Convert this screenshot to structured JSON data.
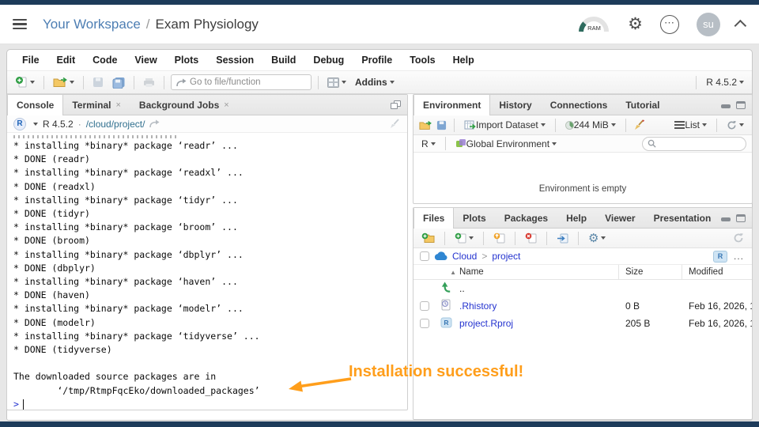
{
  "header": {
    "workspace": "Your Workspace",
    "separator": "/",
    "project": "Exam Physiology",
    "ram_label": "RAM",
    "avatar_initials": "su"
  },
  "menubar": {
    "items": [
      "File",
      "Edit",
      "Code",
      "View",
      "Plots",
      "Session",
      "Build",
      "Debug",
      "Profile",
      "Tools",
      "Help"
    ]
  },
  "toolbar": {
    "goto_placeholder": "Go to file/function",
    "addins_label": "Addins",
    "r_version_label": "R 4.5.2"
  },
  "console_pane": {
    "tabs": [
      {
        "label": "Console",
        "active": true
      },
      {
        "label": "Terminal",
        "closable": true
      },
      {
        "label": "Background Jobs",
        "closable": true
      }
    ],
    "r_version": "R 4.5.2",
    "dot": "·",
    "working_dir": "/cloud/project/",
    "output_lines": [
      "* installing *binary* package ‘readr’ ...",
      "* DONE (readr)",
      "* installing *binary* package ‘readxl’ ...",
      "* DONE (readxl)",
      "* installing *binary* package ‘tidyr’ ...",
      "* DONE (tidyr)",
      "* installing *binary* package ‘broom’ ...",
      "* DONE (broom)",
      "* installing *binary* package ‘dbplyr’ ...",
      "* DONE (dbplyr)",
      "* installing *binary* package ‘haven’ ...",
      "* DONE (haven)",
      "* installing *binary* package ‘modelr’ ...",
      "* DONE (modelr)",
      "* installing *binary* package ‘tidyverse’ ...",
      "* DONE (tidyverse)",
      "",
      "The downloaded source packages are in",
      "        ‘/tmp/RtmpFqcEko/downloaded_packages’"
    ],
    "prompt": ">"
  },
  "environment_pane": {
    "tabs": [
      {
        "label": "Environment",
        "active": true
      },
      {
        "label": "History"
      },
      {
        "label": "Connections"
      },
      {
        "label": "Tutorial"
      }
    ],
    "import_label": "Import Dataset",
    "memory_label": "244 MiB",
    "list_label": "List",
    "language_label": "R",
    "scope_label": "Global Environment",
    "empty_message": "Environment is empty"
  },
  "files_pane": {
    "tabs": [
      {
        "label": "Files",
        "active": true
      },
      {
        "label": "Plots"
      },
      {
        "label": "Packages"
      },
      {
        "label": "Help"
      },
      {
        "label": "Viewer"
      },
      {
        "label": "Presentation"
      }
    ],
    "breadcrumb": {
      "root": "Cloud",
      "separator": ">",
      "current": "project"
    },
    "project_badge": "R",
    "overflow_label": "...",
    "columns": {
      "name": "Name",
      "size": "Size",
      "modified": "Modified",
      "sort_glyph": "▲"
    },
    "rows": [
      {
        "icon": "up-dir-icon",
        "name": "..",
        "size": "",
        "modified": "",
        "link": false,
        "checkbox": false
      },
      {
        "icon": "rhistory-file-icon",
        "name": ".Rhistory",
        "size": "0 B",
        "modified": "Feb 16, 2026, 1",
        "link": true,
        "checkbox": true
      },
      {
        "icon": "rproj-file-icon",
        "name": "project.Rproj",
        "size": "205 B",
        "modified": "Feb 16, 2026, 1",
        "link": true,
        "checkbox": true
      }
    ]
  },
  "annotation": {
    "text": "Installation successful!",
    "color": "#ff9e1b"
  },
  "colors": {
    "chrome_strip": "#1d3b5a",
    "workspace_link": "#4d7eb3",
    "file_link": "#2433cf",
    "annotation_orange": "#ff9e1b"
  }
}
